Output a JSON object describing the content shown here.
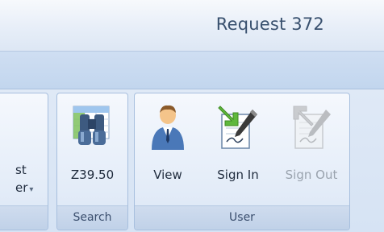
{
  "window": {
    "title": "Request 372"
  },
  "ribbon": {
    "partial_group": {
      "label_line1": "st",
      "label_line2": "er",
      "dropdown_arrow": "▾"
    },
    "search_group": {
      "caption": "Search",
      "button_label": "Z39.50",
      "icon": "binoculars-icon"
    },
    "user_group": {
      "caption": "User",
      "buttons": [
        {
          "label": "View",
          "icon": "user-person-icon",
          "enabled": true
        },
        {
          "label": "Sign In",
          "icon": "sign-in-icon",
          "enabled": true
        },
        {
          "label": "Sign Out",
          "icon": "sign-out-icon",
          "enabled": false
        }
      ]
    }
  }
}
